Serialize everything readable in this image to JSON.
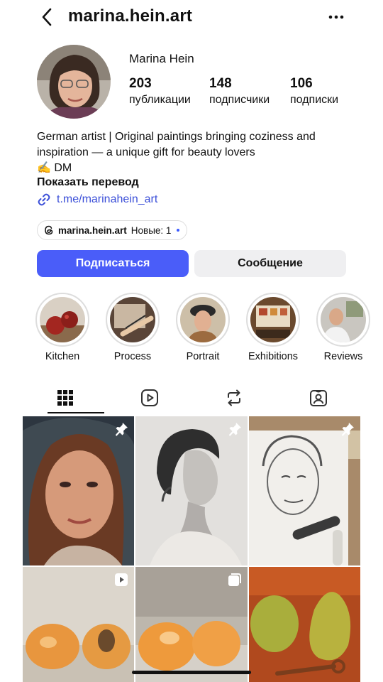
{
  "header": {
    "username": "marina.hein.art",
    "back_icon": "chevron-left-icon",
    "more_icon": "more-horizontal-icon"
  },
  "profile": {
    "display_name": "Marina Hein",
    "stats": [
      {
        "value": "203",
        "label": "публикации"
      },
      {
        "value": "148",
        "label": "подписчики"
      },
      {
        "value": "106",
        "label": "подписки"
      }
    ],
    "bio_line1": "German artist | Original paintings bringing coziness and",
    "bio_line2": "inspiration — a unique gift for beauty lovers",
    "bio_line3": "✍️ DM",
    "translate": "Показать перевод",
    "link": "t.me/marinahein_art",
    "threads": {
      "name": "marina.hein.art",
      "new_label": "Новые: 1"
    }
  },
  "actions": {
    "follow": "Подписаться",
    "message": "Сообщение"
  },
  "highlights": [
    {
      "label": "Kitchen"
    },
    {
      "label": "Process"
    },
    {
      "label": "Portrait"
    },
    {
      "label": "Exhibitions"
    },
    {
      "label": "Reviews"
    }
  ],
  "tabs": [
    {
      "icon": "grid-icon",
      "active": true
    },
    {
      "icon": "reels-icon",
      "active": false
    },
    {
      "icon": "reposts-icon",
      "active": false
    },
    {
      "icon": "tagged-icon",
      "active": false
    }
  ],
  "posts": [
    {
      "subject": "portrait-woman-painting",
      "badge": "pin-icon"
    },
    {
      "subject": "charcoal-profile-drawing",
      "badge": "pin-icon"
    },
    {
      "subject": "man-portrait-sketch",
      "badge": "pin-icon"
    },
    {
      "subject": "apricots-painting",
      "badge": "reel-icon"
    },
    {
      "subject": "apricots-still-life",
      "badge": "carousel-icon"
    },
    {
      "subject": "pears-painting",
      "badge": ""
    }
  ],
  "colors": {
    "accent": "#4a5df9",
    "link": "#3b4fd8",
    "secondary_button": "#efeff1"
  }
}
